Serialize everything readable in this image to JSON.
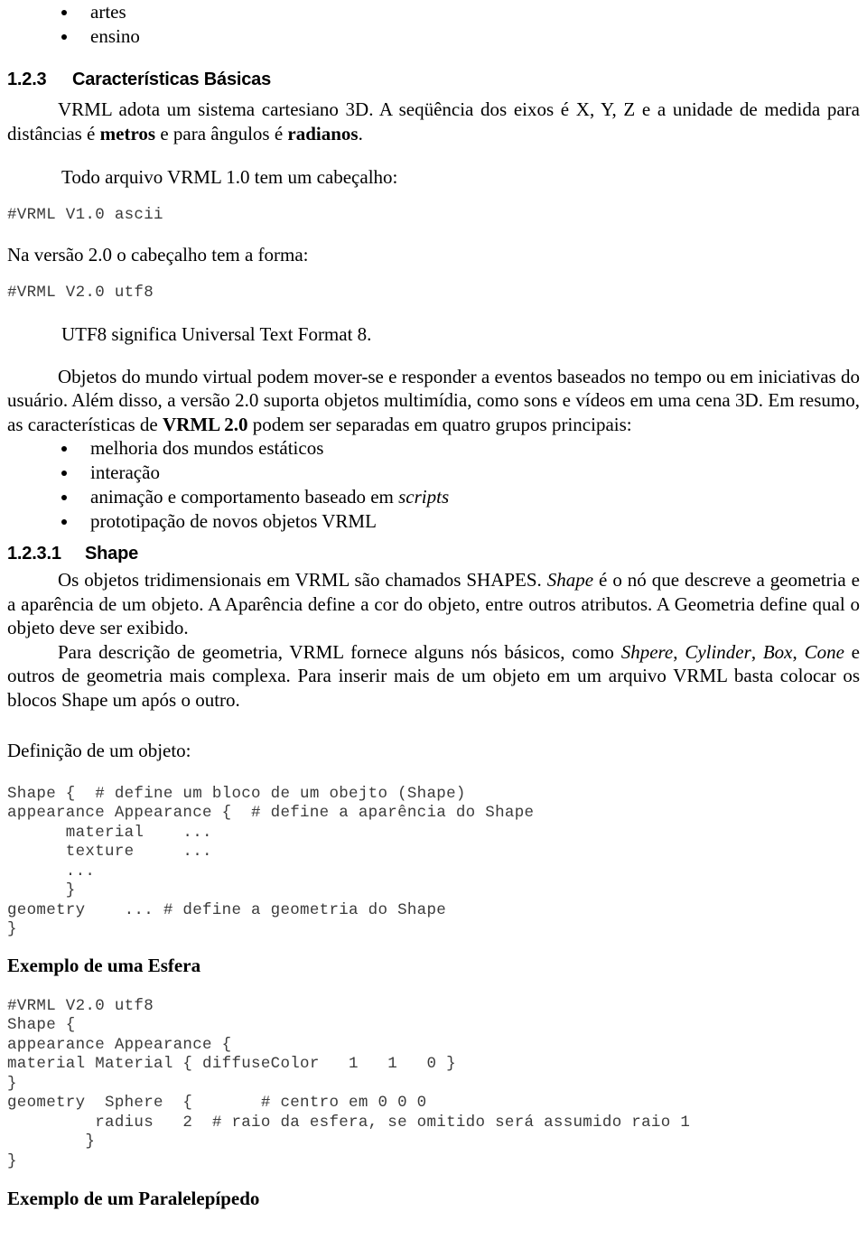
{
  "document": {
    "top_list": {
      "items": [
        "artes",
        "ensino"
      ]
    },
    "section_1_2_3": {
      "number": "1.2.3",
      "title": "Características Básicas",
      "paragraph_html": "VRML adota um sistema cartesiano 3D. A seqüência dos eixos é X, Y, Z e a unidade de medida para distâncias é <b>metros</b> e para ângulos é <b>radianos</b>.",
      "line_todo_arquivo": "Todo arquivo VRML 1.0 tem um cabeçalho:",
      "code_v1": "#VRML V1.0 ascii",
      "line_na_versao": "Na versão 2.0 o cabeçalho tem a forma:",
      "code_v2": "#VRML V2.0 utf8",
      "line_utf8": "UTF8 significa Universal Text Format 8.",
      "paragraph_objetos_html": "Objetos do mundo virtual podem mover-se e responder a eventos baseados no tempo ou em iniciativas do usuário. Além disso, a versão 2.0 suporta objetos multimídia, como sons e vídeos em uma cena 3D. Em resumo, as características de <b>VRML 2.0</b> podem ser separadas em quatro grupos principais:",
      "features_list": [
        "melhoria dos mundos estáticos",
        "interação",
        "animação e comportamento baseado em <i>scripts</i>",
        "prototipação de novos objetos VRML"
      ]
    },
    "section_1_2_3_1": {
      "number": "1.2.3.1",
      "title": "Shape",
      "paragraph_1_html": "Os objetos tridimensionais em VRML são chamados SHAPES. <i>Shape</i> é o nó que descreve a geometria e a aparência de um objeto. A Aparência define a cor do objeto, entre outros atributos. A Geometria define qual o objeto deve ser exibido.",
      "paragraph_2_html": "Para descrição de geometria, VRML fornece alguns nós básicos, como <i>Shpere</i>, <i>Cylinder</i>, <i>Box</i>, <i>Cone</i> e outros de geometria mais complexa. Para inserir mais de um objeto em um arquivo VRML basta colocar os blocos Shape um após o outro.",
      "definition_label": "Definição de um objeto:",
      "definition_code": "Shape {  # define um bloco de um obejto (Shape)\nappearance Appearance {  # define a aparência do Shape\n      material    ...\n      texture     ...\n      ...\n      }\ngeometry    ... # define a geometria do Shape\n}"
    },
    "example_sphere": {
      "heading": "Exemplo de uma Esfera",
      "code": "#VRML V2.0 utf8\nShape {\nappearance Appearance {\nmaterial Material { diffuseColor   1   1   0 }\n}\ngeometry  Sphere  {       # centro em 0 0 0\n         radius   2  # raio da esfera, se omitido será assumido raio 1\n        }\n}"
    },
    "example_box": {
      "heading": "Exemplo de um Paralelepípedo"
    },
    "colors": {
      "text": "#000000",
      "code_text": "#3a3a3a",
      "page_background": "#ffffff"
    }
  }
}
